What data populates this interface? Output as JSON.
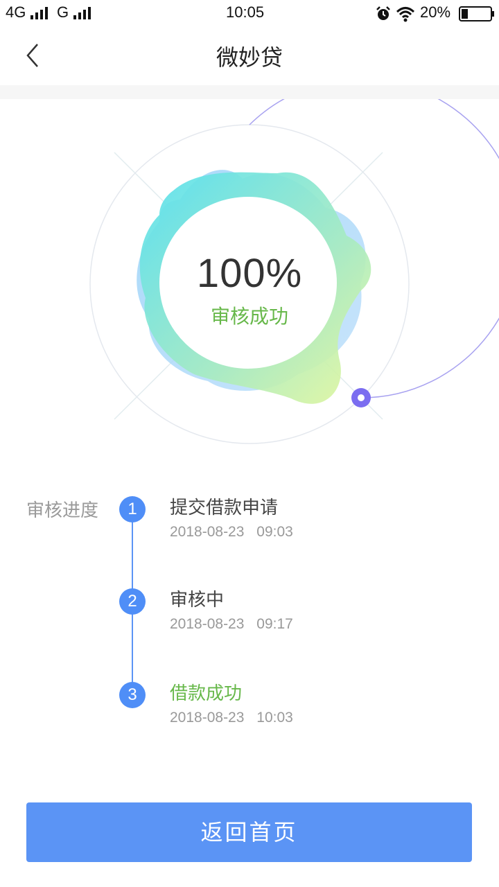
{
  "status_bar": {
    "network_1": "4G",
    "network_2": "G",
    "time": "10:05",
    "battery": "20%",
    "icons": [
      "signal-icon",
      "alarm-icon",
      "wifi-icon",
      "battery-icon"
    ]
  },
  "header": {
    "title": "微妙贷",
    "back_icon": "chevron-left-icon"
  },
  "hero": {
    "percent": "100%",
    "status": "审核成功",
    "progress_fraction": 1.0
  },
  "progress": {
    "title": "审核进度",
    "steps": [
      {
        "num": "1",
        "name": "提交借款申请",
        "date": "2018-08-23",
        "time": "09:03"
      },
      {
        "num": "2",
        "name": "审核中",
        "date": "2018-08-23",
        "time": "09:17"
      },
      {
        "num": "3",
        "name": "借款成功",
        "date": "2018-08-23",
        "time": "10:03"
      }
    ]
  },
  "footer": {
    "home_label": "返回首页"
  },
  "colors": {
    "accent_blue": "#5b94f5",
    "success_green": "#67b84a",
    "ring_purple": "#7b6df0"
  }
}
